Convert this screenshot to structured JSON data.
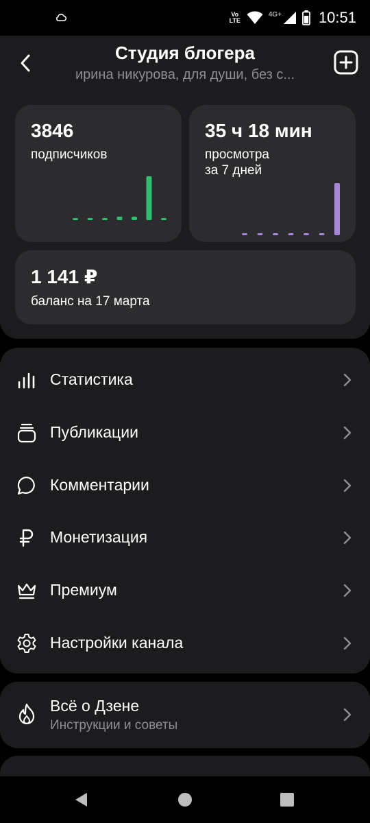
{
  "status_bar": {
    "time": "10:51",
    "network": "4G+",
    "volte_top": "Vo",
    "volte_bottom": "LTE",
    "icons": [
      "cloud-icon",
      "volte-icon",
      "wifi-icon",
      "signal-icon",
      "battery-icon"
    ]
  },
  "header": {
    "title": "Студия блогера",
    "subtitle": "ирина никурова, для души, без с...",
    "back_icon": "chevron-left-icon",
    "add_icon": "plus-square-icon"
  },
  "stats": {
    "subscribers": {
      "value": "3846",
      "label": "подписчиков",
      "accent": "#30c070",
      "bars": [
        0,
        0,
        0,
        0.08,
        0.08,
        1,
        0
      ]
    },
    "views": {
      "value": "35 ч 18 мин",
      "label_line1": "просмотра",
      "label_line2": "за 7 дней",
      "accent": "#a887d6",
      "bars": [
        0,
        0,
        0,
        0,
        0,
        0,
        1
      ]
    },
    "balance": {
      "value": "1 141 ₽",
      "label": "баланс на 17 марта"
    }
  },
  "menu": {
    "items": [
      {
        "label": "Статистика",
        "icon": "bar-chart-icon"
      },
      {
        "label": "Публикации",
        "icon": "stack-icon"
      },
      {
        "label": "Комментарии",
        "icon": "chat-bubble-icon"
      },
      {
        "label": "Монетизация",
        "icon": "ruble-icon"
      },
      {
        "label": "Премиум",
        "icon": "crown-icon"
      },
      {
        "label": "Настройки канала",
        "icon": "gear-icon"
      }
    ]
  },
  "about": {
    "title": "Всё о Дзене",
    "subtitle": "Инструкции и советы",
    "icon": "flame-icon"
  },
  "colors": {
    "background": "#000000",
    "surface": "#1c1c1e",
    "card": "#2c2c2e",
    "secondary_text": "#8e8e93"
  }
}
